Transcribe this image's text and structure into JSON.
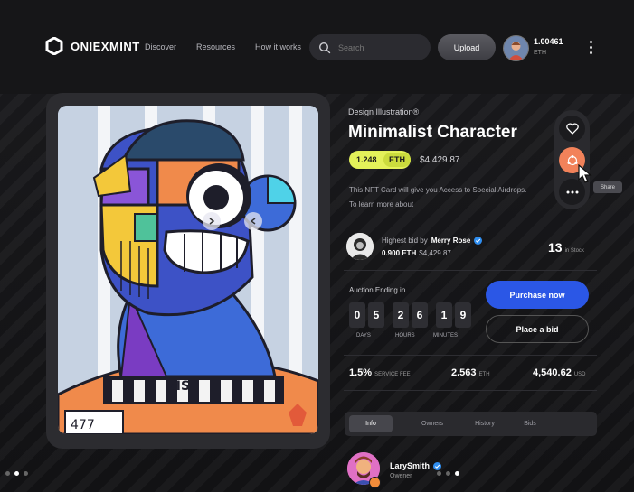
{
  "header": {
    "logo_text": "ONIEXMINT",
    "nav": [
      "Discover",
      "Resources",
      "How it works"
    ],
    "search_placeholder": "Search",
    "upload_label": "Upload",
    "balance_value": "1.00461",
    "balance_unit": "ETH"
  },
  "product": {
    "category": "Design Illustration®",
    "title": "Minimalist Character",
    "eth_price": "1.248",
    "eth_unit": "ETH",
    "usd_price": "$4,429.87",
    "description": "This NFT Card will give you Access to Special Airdrops. To learn more about"
  },
  "actions": {
    "icons": [
      "heart-icon",
      "share-icon",
      "more-icon"
    ],
    "tooltip": "Share"
  },
  "bid": {
    "label": "Highest bid by",
    "bidder": "Merry Rose",
    "eth": "0.900 ETH",
    "usd": "$4,429.87",
    "stock_count": "13",
    "stock_label": "in Stock"
  },
  "auction": {
    "label": "Auction Ending in",
    "days": [
      "0",
      "5"
    ],
    "hours": [
      "2",
      "6"
    ],
    "minutes": [
      "1",
      "9"
    ],
    "days_label": "DAYS",
    "hours_label": "HOURS",
    "minutes_label": "MINUTES",
    "purchase_label": "Purchase now",
    "place_bid_label": "Place a bid"
  },
  "stats": {
    "fee_value": "1.5%",
    "fee_label": "SERVICE FEE",
    "eth_value": "2.563",
    "eth_label": "ETH",
    "usd_value": "4,540.62",
    "usd_label": "USD"
  },
  "tabs": [
    "Info",
    "Owners",
    "History",
    "Bids"
  ],
  "owner": {
    "name": "LarySmith",
    "role": "Owener"
  },
  "colors": {
    "accent_blue": "#2b57e6",
    "price_yellow": "#e3f15a",
    "share_orange": "#f2825a"
  }
}
